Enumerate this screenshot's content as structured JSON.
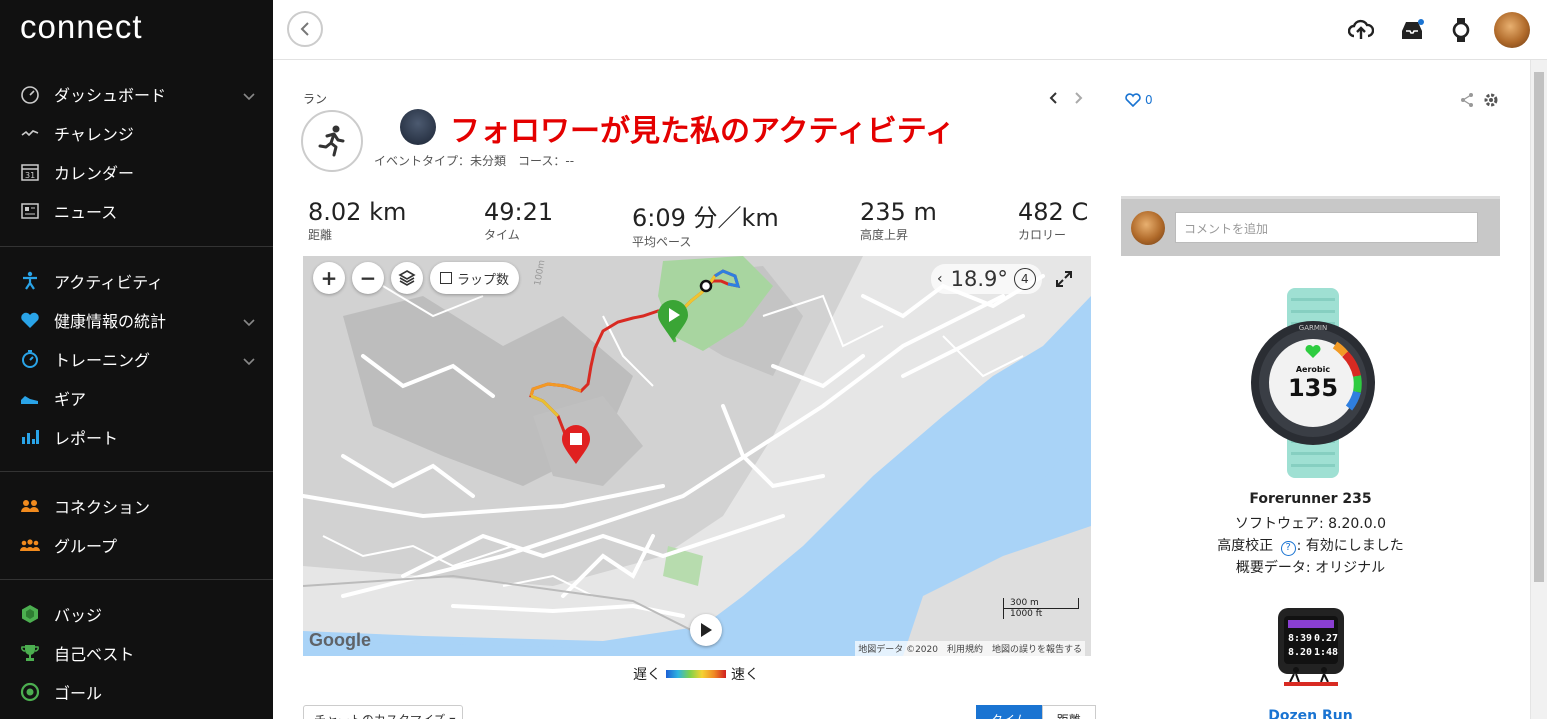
{
  "app": {
    "logo": "connect"
  },
  "sidebar": {
    "groups": [
      [
        {
          "label": "ダッシュボード",
          "icon": "dashboard-icon",
          "expandable": true
        },
        {
          "label": "チャレンジ",
          "icon": "challenge-icon",
          "expandable": false
        },
        {
          "label": "カレンダー",
          "icon": "calendar-icon",
          "expandable": false
        },
        {
          "label": "ニュース",
          "icon": "news-icon",
          "expandable": false
        }
      ],
      [
        {
          "label": "アクティビティ",
          "icon": "activity-icon",
          "expandable": false
        },
        {
          "label": "健康情報の統計",
          "icon": "heart-icon",
          "expandable": true
        },
        {
          "label": "トレーニング",
          "icon": "stopwatch-icon",
          "expandable": true
        },
        {
          "label": "ギア",
          "icon": "shoe-icon",
          "expandable": false
        },
        {
          "label": "レポート",
          "icon": "report-icon",
          "expandable": false
        }
      ],
      [
        {
          "label": "コネクション",
          "icon": "connections-icon",
          "expandable": false
        },
        {
          "label": "グループ",
          "icon": "groups-icon",
          "expandable": false
        }
      ],
      [
        {
          "label": "バッジ",
          "icon": "badge-icon",
          "expandable": false
        },
        {
          "label": "自己ベスト",
          "icon": "trophy-icon",
          "expandable": false
        },
        {
          "label": "ゴール",
          "icon": "goal-icon",
          "expandable": false
        }
      ]
    ]
  },
  "activity": {
    "type_label": "ラン",
    "title": "フォロワーが見た私のアクティビティ",
    "subline": "イベントタイプ：未分類　コース：--",
    "stats": [
      {
        "value": "8.02 km",
        "label": "距離"
      },
      {
        "value": "49:21",
        "label": "タイム"
      },
      {
        "value": "6:09 分／km",
        "label": "平均ペース"
      },
      {
        "value": "235 m",
        "label": "高度上昇"
      },
      {
        "value": "482 C",
        "label": "カロリー"
      }
    ]
  },
  "map": {
    "zoom_in": "+",
    "zoom_out": "−",
    "lap_label": "ラップ数",
    "temperature": "18.9°",
    "wind": "4",
    "google": "Google",
    "credit": "地図データ ©2020　利用規約　地図の誤りを報告する",
    "scale_m": "300 m",
    "scale_ft": "1000 ft"
  },
  "legend": {
    "slow": "遅く",
    "fast": "速く"
  },
  "chart": {
    "customize": "チャートのカスタマイズ ▾",
    "time": "タイム",
    "distance": "距離"
  },
  "social": {
    "likes": "0",
    "comment_placeholder": "コメントを追加"
  },
  "device": {
    "name": "Forerunner 235",
    "software": "ソフトウェア: 8.20.0.0",
    "elevation_prefix": "高度校正",
    "elevation_suffix": ": 有効にしました",
    "summary": "概要データ: オリジナル",
    "watch_brand": "GARMIN",
    "watch_mode": "Aerobic",
    "watch_hr": "135",
    "watch2_time": "8:39",
    "watch2_a": "0.27",
    "watch2_b": "8.20",
    "watch2_c": "1:48",
    "group_name": "Dozen Run"
  },
  "colors": {
    "sidebar_bg": "#111111",
    "title_red": "#e40000",
    "link_blue": "#1a74d2"
  }
}
